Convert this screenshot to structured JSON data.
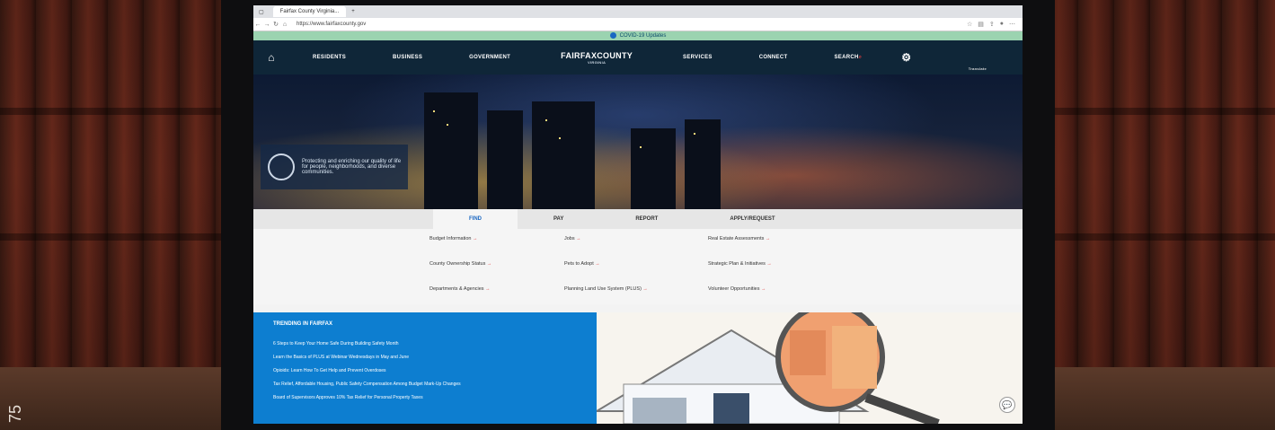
{
  "browser": {
    "tab_title": "Fairfax County Virginia...",
    "url": "https://www.fairfaxcounty.gov"
  },
  "alert": {
    "text": "COVID-19 Updates"
  },
  "nav": {
    "items": [
      "RESIDENTS",
      "BUSINESS",
      "GOVERNMENT"
    ],
    "logo": "FAIRFAXCOUNTY",
    "logo_sub": "VIRGINIA",
    "right_items": [
      "SERVICES",
      "CONNECT"
    ],
    "search": "SEARCH",
    "translate": "Translate"
  },
  "hero": {
    "mission": "Protecting and enriching our quality of life for people, neighborhoods, and diverse communities."
  },
  "quick_tabs": [
    "FIND",
    "PAY",
    "REPORT",
    "APPLY/REQUEST"
  ],
  "quick_links": [
    "Budget Information",
    "Jobs",
    "Real Estate Assessments",
    "County Ownership Status",
    "Pets to Adopt",
    "Strategic Plan & Initiatives",
    "Departments & Agencies",
    "Planning Land Use System (PLUS)",
    "Volunteer Opportunities"
  ],
  "trending": {
    "title": "TRENDING IN FAIRFAX",
    "items": [
      "6 Steps to Keep Your Home Safe During Building Safety Month",
      "Learn the Basics of PLUS at Webinar Wednesdays in May and June",
      "Opioids: Learn How To Get Help and Prevent Overdoses",
      "Tax Relief, Affordable Housing, Public Safety Compensation Among Budget Mark-Up Changes",
      "Board of Supervisors Approves 10% Tax Relief for Personal Property Taxes"
    ]
  },
  "colors": {
    "navy": "#0f2638",
    "blue": "#0d7ed0",
    "alert": "#9bd3b0",
    "red": "#e03a3a"
  },
  "watermark_side": "75"
}
